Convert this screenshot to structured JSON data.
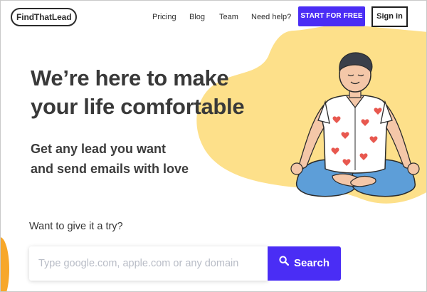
{
  "header": {
    "logo_text": "FindThatLead",
    "nav": [
      {
        "label": "Pricing"
      },
      {
        "label": "Blog"
      },
      {
        "label": "Team"
      },
      {
        "label": "Need help?"
      }
    ],
    "start_button": "START FOR FREE",
    "signin_button": "Sign in"
  },
  "hero": {
    "headline_line1": "We’re here to make",
    "headline_line2": "your life comfortable",
    "subline_line1": "Get any lead you want",
    "subline_line2": "and send emails with love"
  },
  "search": {
    "prompt": "Want to give it a try?",
    "placeholder": "Type google.com, apple.com or any domain",
    "button_label": "Search"
  },
  "icons": {
    "search": "search-icon",
    "illustration": "meditating-man-illustration"
  },
  "colors": {
    "accent": "#4a2df5",
    "blob": "#fde08a",
    "orange": "#f7a72a",
    "text": "#393939"
  }
}
